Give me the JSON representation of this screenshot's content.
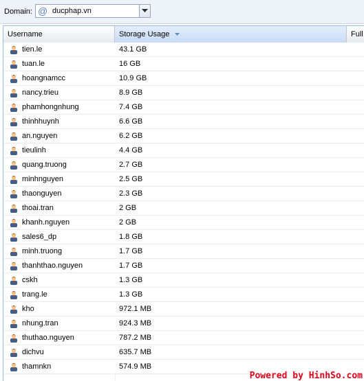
{
  "toolbar": {
    "domain_label": "Domain:",
    "domain_value": "ducphap.vn"
  },
  "grid": {
    "columns": [
      "Username",
      "Storage Usage",
      "Full"
    ],
    "sorted_column": "Storage Usage",
    "sort_direction": "descending",
    "rows": [
      {
        "username": "tien.le",
        "usage": "43.1 GB"
      },
      {
        "username": "tuan.le",
        "usage": "16 GB"
      },
      {
        "username": "hoangnamcc",
        "usage": "10.9 GB"
      },
      {
        "username": "nancy.trieu",
        "usage": "8.9 GB"
      },
      {
        "username": "phamhongnhung",
        "usage": "7.4 GB"
      },
      {
        "username": "thinhhuynh",
        "usage": "6.6 GB"
      },
      {
        "username": "an.nguyen",
        "usage": "6.2 GB"
      },
      {
        "username": "tieulinh",
        "usage": "4.4 GB"
      },
      {
        "username": "quang.truong",
        "usage": "2.7 GB"
      },
      {
        "username": "minhnguyen",
        "usage": "2.5 GB"
      },
      {
        "username": "thaonguyen",
        "usage": "2.3 GB"
      },
      {
        "username": "thoai.tran",
        "usage": "2 GB"
      },
      {
        "username": "khanh.nguyen",
        "usage": "2 GB"
      },
      {
        "username": "sales6_dp",
        "usage": "1.8 GB"
      },
      {
        "username": "minh.truong",
        "usage": "1.7 GB"
      },
      {
        "username": "thanhthao.nguyen",
        "usage": "1.7 GB"
      },
      {
        "username": "cskh",
        "usage": "1.3 GB"
      },
      {
        "username": "trang.le",
        "usage": "1.3 GB"
      },
      {
        "username": "kho",
        "usage": "972.1 MB"
      },
      {
        "username": "nhung.tran",
        "usage": "924.3 MB"
      },
      {
        "username": "thuthao.nguyen",
        "usage": "787.2 MB"
      },
      {
        "username": "dichvu",
        "usage": "635.7 MB"
      },
      {
        "username": "thamnkn",
        "usage": "574.9 MB"
      }
    ]
  },
  "watermark": "Powered by HinhSo.com",
  "colors": {
    "header_sorted": "#c9dbf5",
    "border": "#99bbe8",
    "watermark": "#e0001a"
  },
  "icons": {
    "domain": "at-sign-icon",
    "row": "user-icon",
    "dropdown": "chevron-down-icon",
    "sort": "sort-desc-icon"
  }
}
